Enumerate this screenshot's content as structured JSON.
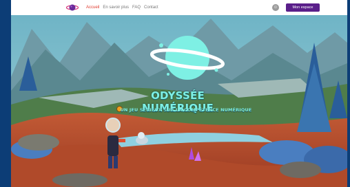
{
  "nav": {
    "items": [
      {
        "label": "Accueil",
        "active": true
      },
      {
        "label": "En savoir plus",
        "active": false
      },
      {
        "label": "FAQ",
        "active": false
      },
      {
        "label": "Contact",
        "active": false
      }
    ],
    "account_button": "Mon espace",
    "accessibility_icon": "accessibility-icon",
    "logo_icon": "planet-logo-icon"
  },
  "hero": {
    "title": "ODYSSÉE NUMÉRIQUE",
    "subtitle": "UN JEU SÉRIEUX SUR LA COMPÉTENCE NUMÉRIQUE"
  },
  "colors": {
    "accent_active": "#e03a2e",
    "button": "#5a1f8a",
    "title": "#7ef0e4",
    "frame": "#0c3d76"
  }
}
